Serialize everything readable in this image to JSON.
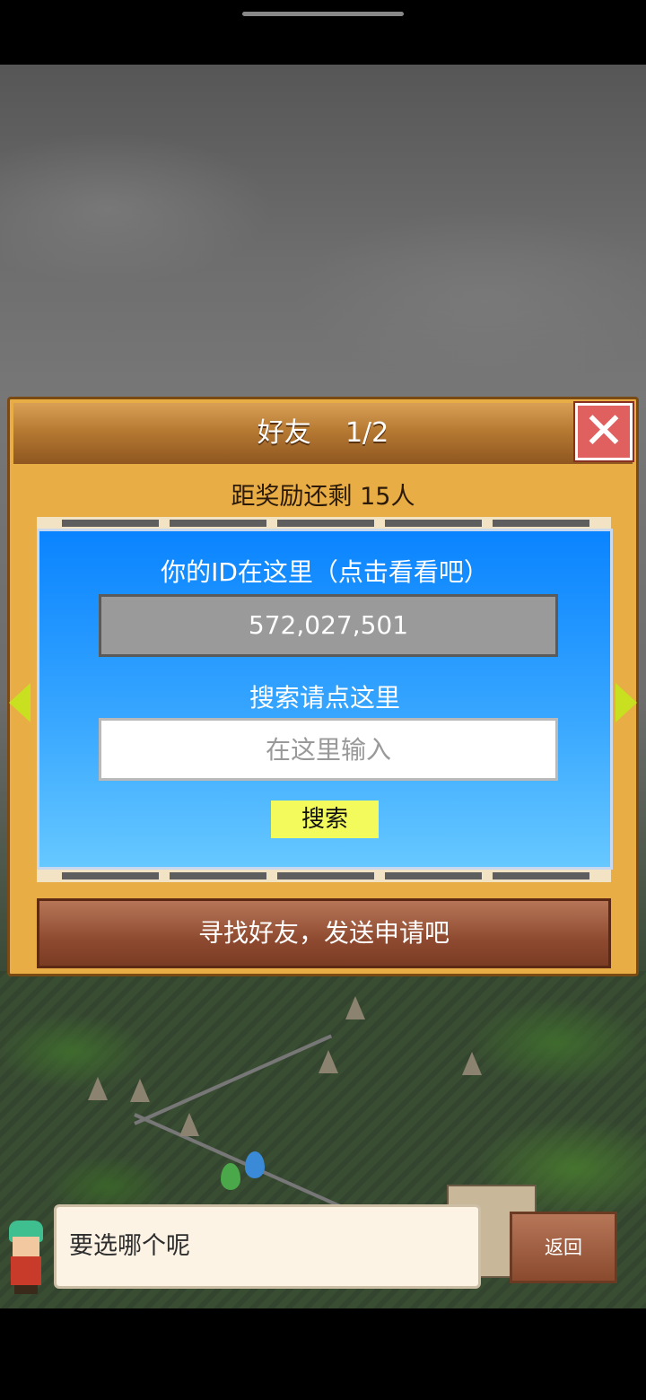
{
  "header": {
    "title": "好友",
    "page": "1/2"
  },
  "reward_text": "距奖励还剩 15人",
  "id_section": {
    "label": "你的ID在这里（点击看看吧）",
    "value": "572,027,501"
  },
  "search_section": {
    "label": "搜索请点这里",
    "placeholder": "在这里输入",
    "button_label": "搜索"
  },
  "find_button_label": "寻找好友，发送申请吧",
  "dialog_text": "要选哪个呢",
  "back_button_label": "返回",
  "colors": {
    "panel": "#e9ad45",
    "blue_box_top": "#0a84ff",
    "search_button": "#f3fb5c",
    "close_button": "#e06060",
    "arrow": "#c8e020"
  },
  "icons": [
    "close-icon",
    "arrow-left-icon",
    "arrow-right-icon"
  ]
}
